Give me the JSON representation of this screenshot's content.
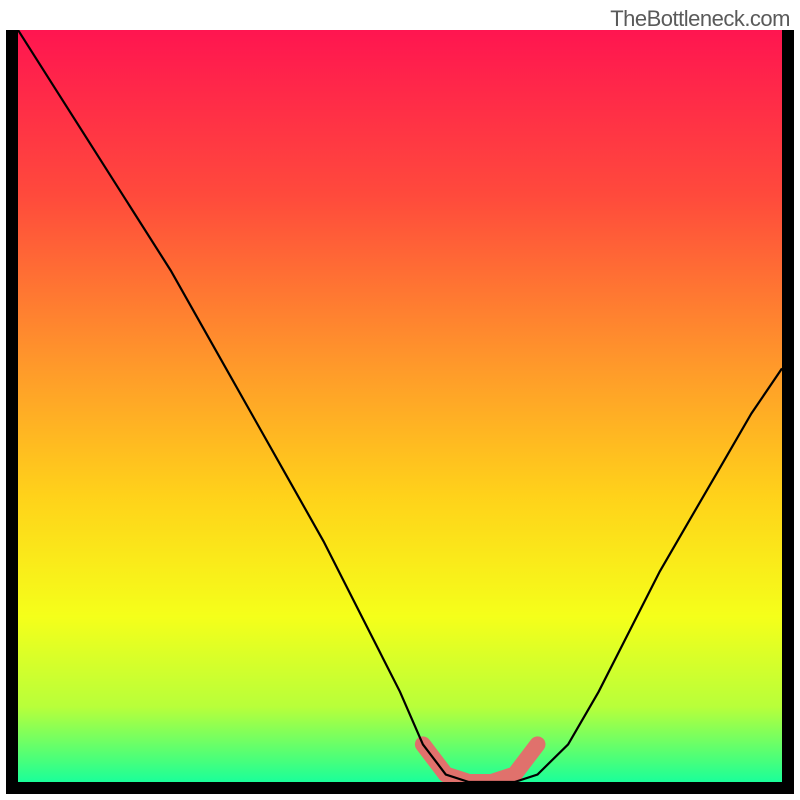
{
  "watermark": "TheBottleneck.com",
  "chart_data": {
    "type": "line",
    "title": "",
    "xlabel": "",
    "ylabel": "",
    "xlim": [
      0,
      100
    ],
    "ylim": [
      0,
      100
    ],
    "x": [
      0,
      5,
      10,
      15,
      20,
      25,
      30,
      35,
      40,
      45,
      50,
      53,
      56,
      59,
      62,
      65,
      68,
      72,
      76,
      80,
      84,
      88,
      92,
      96,
      100
    ],
    "y": [
      100,
      92,
      84,
      76,
      68,
      59,
      50,
      41,
      32,
      22,
      12,
      5,
      1,
      0,
      0,
      0,
      1,
      5,
      12,
      20,
      28,
      35,
      42,
      49,
      55
    ],
    "series": [
      {
        "name": "bottleneck-curve",
        "x": [
          0,
          5,
          10,
          15,
          20,
          25,
          30,
          35,
          40,
          45,
          50,
          53,
          56,
          59,
          62,
          65,
          68,
          72,
          76,
          80,
          84,
          88,
          92,
          96,
          100
        ],
        "y": [
          100,
          92,
          84,
          76,
          68,
          59,
          50,
          41,
          32,
          22,
          12,
          5,
          1,
          0,
          0,
          0,
          1,
          5,
          12,
          20,
          28,
          35,
          42,
          49,
          55
        ]
      }
    ],
    "background_gradient": {
      "stops": [
        {
          "pos": 0.0,
          "color": "#ff1550"
        },
        {
          "pos": 0.22,
          "color": "#ff4a3c"
        },
        {
          "pos": 0.45,
          "color": "#ff9a2a"
        },
        {
          "pos": 0.62,
          "color": "#ffd21a"
        },
        {
          "pos": 0.78,
          "color": "#f5ff1a"
        },
        {
          "pos": 0.9,
          "color": "#b8ff3a"
        },
        {
          "pos": 0.97,
          "color": "#4aff7a"
        },
        {
          "pos": 1.0,
          "color": "#1aff9a"
        }
      ]
    },
    "highlight": {
      "color": "#e0716c",
      "x": [
        53,
        56,
        59,
        62,
        65,
        68
      ],
      "y": [
        5,
        1,
        0,
        0,
        1,
        5
      ]
    }
  }
}
